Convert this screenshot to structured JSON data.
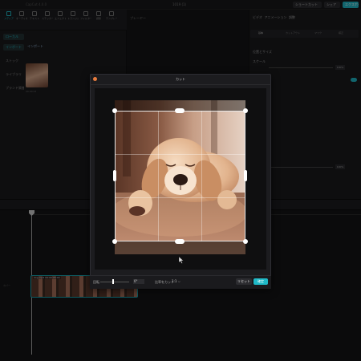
{
  "app": {
    "name": "CapCut 4.0.0",
    "project": "1019 (1)",
    "top_buttons": {
      "shortcut": "ショートカット",
      "share": "シェア",
      "export": "エクスポート"
    }
  },
  "media_panel": {
    "tools": [
      "メディア",
      "オーディオ",
      "テキスト",
      "ステッカー",
      "エフェクト",
      "トランジション",
      "フィルター",
      "調整",
      "テンプレート"
    ],
    "side_items": [
      "ローカル",
      "インポート",
      "ストック",
      "ライブラリ",
      "ブランド資産"
    ],
    "import_label": "インポート",
    "thumb_label": "00:00:05"
  },
  "player": {
    "label": "プレーヤー"
  },
  "right_panel": {
    "tabs": [
      "ビデオ",
      "アニメーション",
      "調整"
    ],
    "subtabs": [
      "基本",
      "カットアウト",
      "マスク",
      "補正"
    ],
    "rows": [
      "位置とサイズ",
      "スケール"
    ],
    "values": [
      "100%",
      "100%"
    ]
  },
  "timeline": {
    "track_label": "カバー",
    "clip_label": "dog.mp4  00:00:05:00"
  },
  "crop_dialog": {
    "title": "カット",
    "rotate_label": "回転",
    "rotate_value": "0°",
    "ratio_label": "比率をカット",
    "ratio_value": "1:1",
    "reset_label": "リセット",
    "confirm_label": "確定",
    "crop_ratio": "1:1",
    "rotate_degrees": 0
  },
  "colors": {
    "accent": "#1fb9c7",
    "dialog_bg": "#1c1c1f",
    "app_bg": "#121214"
  },
  "icons": {
    "playhead": "playhead-marker-icon",
    "cursor": "mouse-cursor-icon",
    "dialog": "window-dot-icon",
    "dropdown": "chevron-down-icon"
  }
}
